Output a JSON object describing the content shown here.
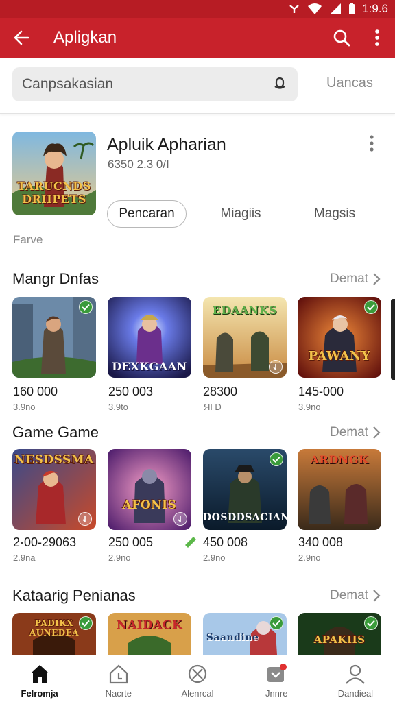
{
  "status_bar": {
    "time": "1:9.6"
  },
  "app_bar": {
    "title": "Apligkan"
  },
  "search": {
    "placeholder": "Canpsakasian",
    "cancel_label": "Uancas"
  },
  "featured": {
    "title": "Apluik Apharian",
    "subtitle": "6350 2.3 0/I",
    "art_text": "TARUCNDS DRIIPETS",
    "chips": [
      "Pencaran",
      "Miagiis",
      "Magsis"
    ],
    "footer_label": "Farve"
  },
  "sections": [
    {
      "title": "Mangr Dnfas",
      "more_label": "Demat",
      "cards": [
        {
          "count": "160 000",
          "sub": "3.9no",
          "art_text": "",
          "badge": "check"
        },
        {
          "count": "250 003",
          "sub": "3.9to",
          "art_text": "DEXKGAAN",
          "badge": "none"
        },
        {
          "count": "28300",
          "sub": "ЯГÐ",
          "art_text": "EDAANKS",
          "badge": "corner"
        },
        {
          "count": "145-000",
          "sub": "3.9no",
          "art_text": "PAWANY",
          "badge": "check"
        }
      ]
    },
    {
      "title": "Game Game",
      "more_label": "Demat",
      "cards": [
        {
          "count": "2·00-29063",
          "sub": "2.9na",
          "art_text": "NESDSSMA",
          "badge": "corner"
        },
        {
          "count": "250 005",
          "sub": "2.9no",
          "art_text": "AFONIS",
          "badge": "corner"
        },
        {
          "count": "450 008",
          "sub": "2.9no",
          "art_text": "DOSDDSACIAN",
          "badge": "check"
        },
        {
          "count": "340 008",
          "sub": "2.9no",
          "art_text": "ARDNGK",
          "badge": "none"
        }
      ]
    },
    {
      "title": "Kataarig Penianas",
      "more_label": "Demat",
      "cards": [
        {
          "art_text": "PADIKX AUNEDEA",
          "badge": "check"
        },
        {
          "art_text": "NAIDACK",
          "badge": "none"
        },
        {
          "art_text": "Saandine",
          "badge": "check"
        },
        {
          "art_text": "APAKIIS",
          "badge": "check"
        }
      ]
    }
  ],
  "bottom_nav": [
    {
      "label": "Felromja",
      "icon": "home-icon",
      "active": true
    },
    {
      "label": "Nacrte",
      "icon": "house-outline-icon",
      "active": false
    },
    {
      "label": "Alenrcal",
      "icon": "circle-x-icon",
      "active": false
    },
    {
      "label": "Jnnre",
      "icon": "download-box-icon",
      "active": false
    },
    {
      "label": "Dandieal",
      "icon": "person-icon",
      "active": false
    }
  ],
  "colors": {
    "primary": "#c8222b",
    "status_bar": "#b71c24",
    "badge_green": "#3a9b3a"
  }
}
